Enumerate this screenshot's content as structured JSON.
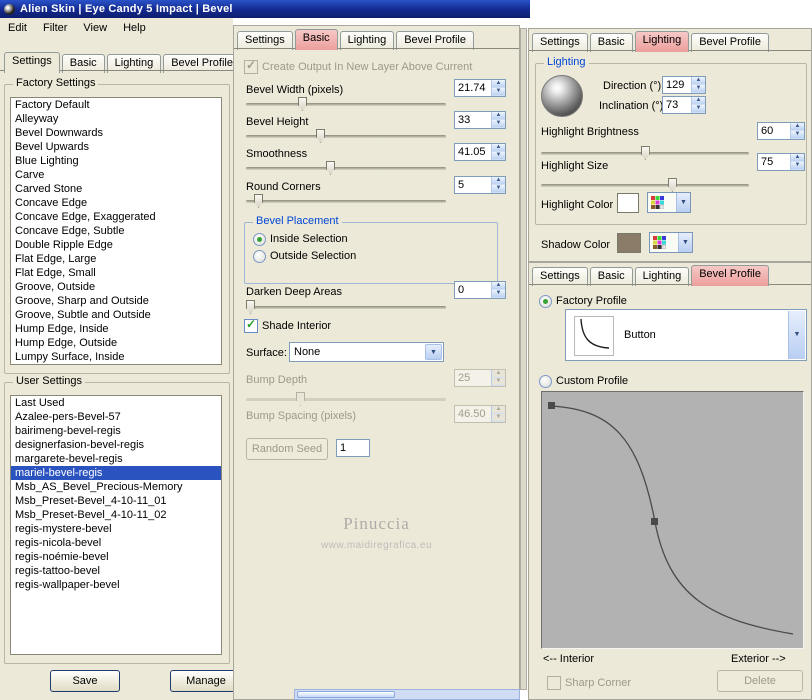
{
  "window": {
    "title": "Alien Skin | Eye Candy 5 Impact | Bevel"
  },
  "menu": {
    "items": [
      "Edit",
      "Filter",
      "View",
      "Help"
    ]
  },
  "tab_labels": [
    "Settings",
    "Basic",
    "Lighting",
    "Bevel Profile"
  ],
  "left_panel": {
    "active_tab": "Settings",
    "factory_settings": {
      "label": "Factory Settings",
      "items": [
        "Factory Default",
        "Alleyway",
        "Bevel Downwards",
        "Bevel Upwards",
        "Blue Lighting",
        "Carve",
        "Carved Stone",
        "Concave Edge",
        "Concave Edge, Exaggerated",
        "Concave Edge, Subtle",
        "Double Ripple Edge",
        "Flat Edge, Large",
        "Flat Edge, Small",
        "Groove, Outside",
        "Groove, Sharp and Outside",
        "Groove, Subtle and Outside",
        "Hump Edge, Inside",
        "Hump Edge, Outside",
        "Lumpy Surface, Inside"
      ]
    },
    "user_settings": {
      "label": "User Settings",
      "selected": "mariel-bevel-regis",
      "items": [
        "Last Used",
        "Azalee-pers-Bevel-57",
        "bairimeng-bevel-regis",
        "designerfasion-bevel-regis",
        "margarete-bevel-regis",
        "mariel-bevel-regis",
        "Msb_AS_Bevel_Precious-Memory",
        "Msb_Preset-Bevel_4-10-11_01",
        "Msb_Preset-Bevel_4-10-11_02",
        "regis-mystere-bevel",
        "regis-nicola-bevel",
        "regis-noémie-bevel",
        "regis-tattoo-bevel",
        "regis-wallpaper-bevel"
      ]
    },
    "save_button": "Save",
    "manage_button": "Manage"
  },
  "basic_panel": {
    "active_tab": "Basic",
    "create_output_label": "Create Output In New Layer Above Current",
    "bevel_width": {
      "label": "Bevel Width (pixels)",
      "value": "21.74"
    },
    "bevel_height": {
      "label": "Bevel Height",
      "value": "33"
    },
    "smoothness": {
      "label": "Smoothness",
      "value": "41.05"
    },
    "round_corners": {
      "label": "Round Corners",
      "value": "5"
    },
    "bevel_placement": {
      "label": "Bevel Placement",
      "inside": "Inside Selection",
      "outside": "Outside Selection",
      "selected": "Inside Selection"
    },
    "darken_deep_areas": {
      "label": "Darken Deep Areas",
      "value": "0"
    },
    "shade_interior_label": "Shade Interior",
    "surface": {
      "label": "Surface:",
      "value": "None"
    },
    "bump_depth": {
      "label": "Bump Depth",
      "value": "25"
    },
    "bump_spacing": {
      "label": "Bump Spacing (pixels)",
      "value": "46.50"
    },
    "random_seed": {
      "label": "Random Seed",
      "value": "1"
    },
    "watermark": {
      "line1": "Pinuccia",
      "line2": "www.maidiregrafica.eu"
    }
  },
  "lighting_panel": {
    "active_tab": "Lighting",
    "group_label": "Lighting",
    "direction": {
      "label": "Direction (°)",
      "value": "129"
    },
    "inclination": {
      "label": "Inclination (°)",
      "value": "73"
    },
    "highlight_brightness": {
      "label": "Highlight Brightness",
      "value": "60"
    },
    "highlight_size": {
      "label": "Highlight Size",
      "value": "75"
    },
    "highlight_color": {
      "label": "Highlight Color",
      "swatch": "#ffffff"
    },
    "shadow_color": {
      "label": "Shadow Color",
      "swatch": "#8a7c68"
    }
  },
  "profile_panel": {
    "active_tab": "Bevel Profile",
    "factory_profile_label": "Factory Profile",
    "profile_name": "Button",
    "custom_profile_label": "Custom Profile",
    "interior_label": "<-- Interior",
    "exterior_label": "Exterior -->",
    "sharp_corner_label": "Sharp Corner",
    "delete_button": "Delete"
  },
  "colors": {
    "selection_blue": "#2b53c0",
    "active_tab_pink": "#ec9f9c",
    "caption_blue": "#0046d5",
    "highlight_swatch": "#ffffff",
    "shadow_swatch": "#8a7c68"
  }
}
